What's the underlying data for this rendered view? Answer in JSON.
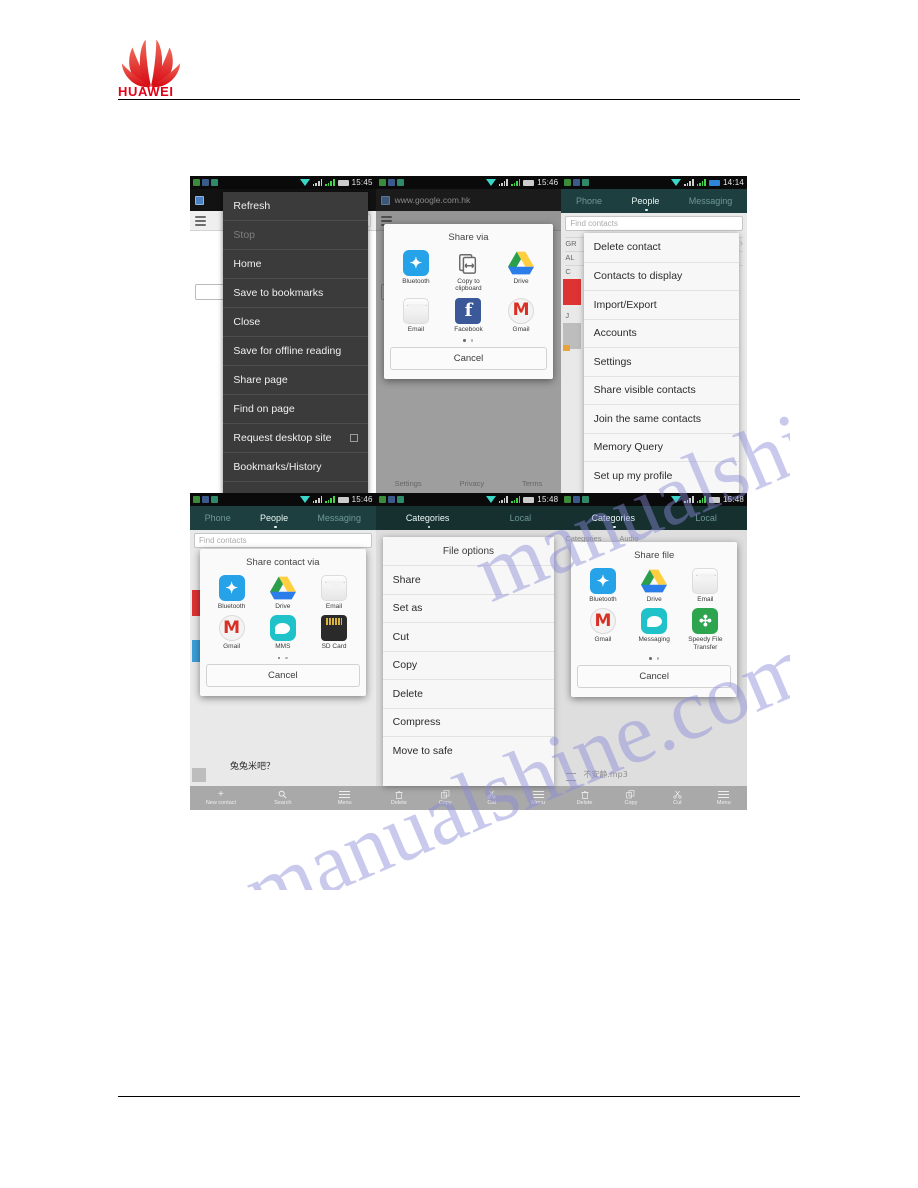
{
  "header": {
    "brand": "HUAWEI"
  },
  "watermark": {
    "line1": "manualshine.com",
    "line2": "manualshine.com"
  },
  "phones": [
    {
      "id": "browser-menu",
      "status": {
        "time": "15:45"
      },
      "url": "",
      "toolbar_tab": "n",
      "menu_title": "",
      "menu_items": [
        {
          "label": "Refresh",
          "disabled": false,
          "checkbox": false
        },
        {
          "label": "Stop",
          "disabled": true,
          "checkbox": false
        },
        {
          "label": "Home",
          "disabled": false,
          "checkbox": false
        },
        {
          "label": "Save to bookmarks",
          "disabled": false,
          "checkbox": false
        },
        {
          "label": "Close",
          "disabled": false,
          "checkbox": false
        },
        {
          "label": "Save for offline reading",
          "disabled": false,
          "checkbox": false
        },
        {
          "label": "Share page",
          "disabled": false,
          "checkbox": false
        },
        {
          "label": "Find on page",
          "disabled": false,
          "checkbox": false
        },
        {
          "label": "Request desktop site",
          "disabled": false,
          "checkbox": true
        },
        {
          "label": "Bookmarks/History",
          "disabled": false,
          "checkbox": false
        }
      ]
    },
    {
      "id": "browser-share",
      "status": {
        "time": "15:46"
      },
      "url": "www.google.com.hk",
      "dialog_title": "Share via",
      "apps": [
        {
          "label": "Bluetooth",
          "icon": "bluetooth-icon"
        },
        {
          "label": "Copy to clipboard",
          "icon": "clipboard-icon"
        },
        {
          "label": "Drive",
          "icon": "drive-icon"
        },
        {
          "label": "Email",
          "icon": "email-icon"
        },
        {
          "label": "Facebook",
          "icon": "facebook-icon"
        },
        {
          "label": "Gmail",
          "icon": "gmail-icon"
        }
      ],
      "cancel": "Cancel",
      "footer": [
        "Settings",
        "Privacy",
        "Terms"
      ]
    },
    {
      "id": "people-menu",
      "status": {
        "time": "14:14"
      },
      "tabs": [
        "Phone",
        "People",
        "Messaging"
      ],
      "active_tab": "People",
      "search_placeholder": "Find contacts",
      "index_labels": [
        "GR",
        "AL",
        "C",
        "J"
      ],
      "menu_items": [
        {
          "label": "Delete contact"
        },
        {
          "label": "Contacts to display"
        },
        {
          "label": "Import/Export"
        },
        {
          "label": "Accounts"
        },
        {
          "label": "Settings"
        },
        {
          "label": "Share visible contacts"
        },
        {
          "label": "Join the same contacts"
        },
        {
          "label": "Memory Query"
        },
        {
          "label": "Set up my profile"
        }
      ]
    },
    {
      "id": "people-share",
      "status": {
        "time": "15:46"
      },
      "tabs": [
        "Phone",
        "People",
        "Messaging"
      ],
      "active_tab": "People",
      "search_placeholder": "Find contacts",
      "contact_name": "兔兔米吧？",
      "dialog_title": "Share contact via",
      "apps": [
        {
          "label": "Bluetooth",
          "icon": "bluetooth-icon"
        },
        {
          "label": "Drive",
          "icon": "drive-icon"
        },
        {
          "label": "Email",
          "icon": "email-icon"
        },
        {
          "label": "Gmail",
          "icon": "gmail-icon"
        },
        {
          "label": "MMS",
          "icon": "mms-icon"
        },
        {
          "label": "SD Card",
          "icon": "sdcard-icon"
        }
      ],
      "cancel": "Cancel",
      "bottom_nav": [
        {
          "label": "New contact",
          "icon": "plus-icon"
        },
        {
          "label": "Search",
          "icon": "search-icon"
        },
        {
          "label": "Menu",
          "icon": "menu-icon"
        }
      ]
    },
    {
      "id": "file-options",
      "status": {
        "time": "15:48"
      },
      "tabs": [
        "Categories",
        "Local"
      ],
      "active_tab": "Categories",
      "dialog_title": "File options",
      "menu_items": [
        {
          "label": "Share"
        },
        {
          "label": "Set as"
        },
        {
          "label": "Cut"
        },
        {
          "label": "Copy"
        },
        {
          "label": "Delete"
        },
        {
          "label": "Compress"
        },
        {
          "label": "Move to safe"
        }
      ],
      "bottom_nav": [
        {
          "label": "Delete",
          "icon": "trash-icon"
        },
        {
          "label": "Copy",
          "icon": "copy-icon"
        },
        {
          "label": "Cut",
          "icon": "scissors-icon"
        },
        {
          "label": "Menu",
          "icon": "menu-icon"
        }
      ]
    },
    {
      "id": "file-share",
      "status": {
        "time": "15:48"
      },
      "tabs": [
        "Categories",
        "Local"
      ],
      "active_tab": "Categories",
      "breadcrumb": [
        "Categories",
        "Audio"
      ],
      "file_name": "不安静.mp3",
      "dialog_title": "Share file",
      "apps": [
        {
          "label": "Bluetooth",
          "icon": "bluetooth-icon"
        },
        {
          "label": "Drive",
          "icon": "drive-icon"
        },
        {
          "label": "Email",
          "icon": "email-icon"
        },
        {
          "label": "Gmail",
          "icon": "gmail-icon"
        },
        {
          "label": "Messaging",
          "icon": "mms-icon"
        },
        {
          "label": "Speedy File Transfer",
          "icon": "speedy-file-transfer-icon"
        }
      ],
      "cancel": "Cancel",
      "bottom_nav": [
        {
          "label": "Delete",
          "icon": "trash-icon"
        },
        {
          "label": "Copy",
          "icon": "copy-icon"
        },
        {
          "label": "Cut",
          "icon": "scissors-icon"
        },
        {
          "label": "Menu",
          "icon": "menu-icon"
        }
      ]
    }
  ]
}
